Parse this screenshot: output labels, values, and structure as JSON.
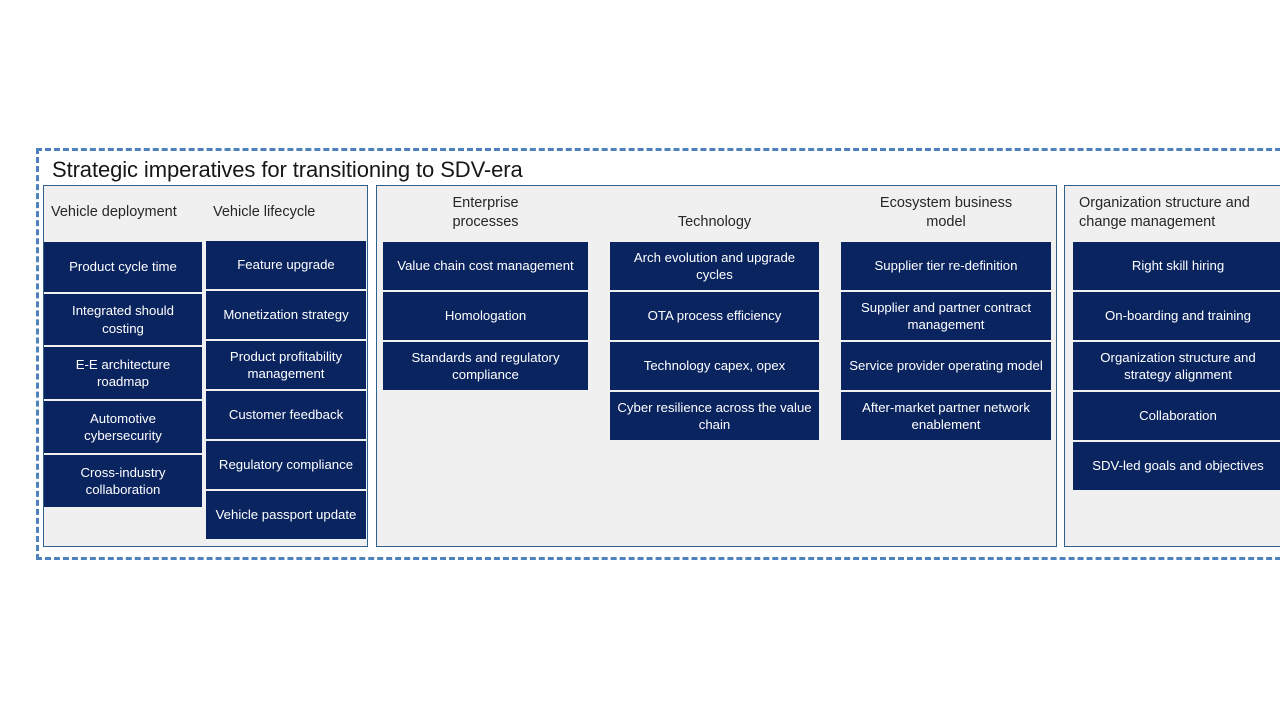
{
  "slide": {
    "title": "Strategic imperatives for transitioning to SDV-era",
    "accent_dashed_border": "#4F81BD",
    "panel_border": "#2E618E",
    "panel_background": "#F0F0F0",
    "box_color": "#0A2460",
    "box_text_color": "#FFFFFF",
    "title_color": "#171717"
  },
  "panels": [
    {
      "name": "vehicle",
      "columns": [
        {
          "header": "Vehicle deployment",
          "items": [
            "Product cycle time",
            "Integrated should costing",
            "E-E architecture roadmap",
            "Automotive cybersecurity",
            "Cross-industry collaboration"
          ]
        },
        {
          "header": "Vehicle lifecycle",
          "items": [
            "Feature upgrade",
            "Monetization strategy",
            "Product profitability management",
            "Customer feedback",
            "Regulatory compliance",
            "Vehicle passport update"
          ]
        }
      ]
    },
    {
      "name": "core",
      "columns": [
        {
          "header": "Enterprise processes",
          "items": [
            "Value chain cost management",
            "Homologation",
            "Standards and regulatory compliance"
          ]
        },
        {
          "header": "Technology",
          "items": [
            "Arch evolution and upgrade cycles",
            "OTA process efficiency",
            "Technology capex, opex",
            "Cyber resilience across the value chain"
          ]
        },
        {
          "header": "Ecosystem business model",
          "items": [
            "Supplier tier re-definition",
            "Supplier and partner contract management",
            "Service provider operating model",
            "After-market partner network enablement"
          ]
        }
      ]
    },
    {
      "name": "org",
      "columns": [
        {
          "header": "Organization structure and change management",
          "items": [
            "Right skill hiring",
            "On-boarding and training",
            "Organization structure and strategy alignment",
            "Collaboration",
            "SDV-led goals and objectives"
          ]
        }
      ]
    }
  ]
}
